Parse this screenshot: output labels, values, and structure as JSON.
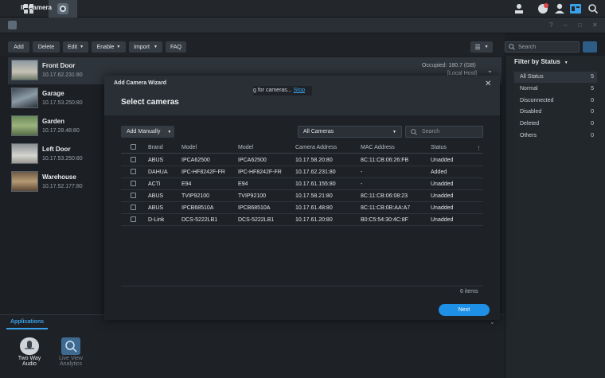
{
  "window": {
    "title": "IP Camera"
  },
  "toolbar": {
    "add": "Add",
    "delete": "Delete",
    "edit": "Edit",
    "enable": "Enable",
    "import": "Import",
    "faq": "FAQ",
    "search_placeholder": "Search"
  },
  "cameras": [
    {
      "name": "Front Door",
      "ip": "10.17.62.231:80"
    },
    {
      "name": "Garage",
      "ip": "10.17.53.250:80"
    },
    {
      "name": "Garden",
      "ip": "10.17.28.48:80"
    },
    {
      "name": "Left Door",
      "ip": "10.17.53.250:80"
    },
    {
      "name": "Warehouse",
      "ip": "10.17.52.177:80"
    }
  ],
  "storage": {
    "occupied": "Occupied: 180.7 (GB)",
    "host": "[Local Host]"
  },
  "filter": {
    "title": "Filter by Status",
    "items": [
      {
        "label": "All Status",
        "count": "5"
      },
      {
        "label": "Normal",
        "count": "5"
      },
      {
        "label": "Disconnected",
        "count": "0"
      },
      {
        "label": "Disabled",
        "count": "0"
      },
      {
        "label": "Deleted",
        "count": "0"
      },
      {
        "label": "Others",
        "count": "0"
      }
    ]
  },
  "applications": {
    "tab": "Applications",
    "items": [
      {
        "label1": "Two Way",
        "label2": "Audio"
      },
      {
        "label1": "Live View",
        "label2": "Analytics"
      }
    ]
  },
  "wizard": {
    "title": "Add Camera Wizard",
    "subtitle": "Select cameras",
    "scanning": "g for cameras...",
    "stop": "Stop",
    "add_manually": "Add Manually",
    "filter_select": "All Cameras",
    "search_placeholder": "Search",
    "columns": [
      "Brand",
      "Model",
      "Model",
      "Camera Address",
      "MAC Address",
      "Status"
    ],
    "rows": [
      {
        "brand": "ABUS",
        "model1": "IPCA62500",
        "model2": "IPCA62500",
        "address": "10.17.58.20:80",
        "mac": "8C:11:CB:06:26:FB",
        "status": "Unadded"
      },
      {
        "brand": "DAHUA",
        "model1": "IPC-HF8242F-FR",
        "model2": "IPC-HF8242F-FR",
        "address": "10.17.62.231:80",
        "mac": "-",
        "status": "Added"
      },
      {
        "brand": "ACTi",
        "model1": "E94",
        "model2": "E94",
        "address": "10.17.61.155:80",
        "mac": "-",
        "status": "Unadded"
      },
      {
        "brand": "ABUS",
        "model1": "TVIP92100",
        "model2": "TVIP92100",
        "address": "10.17.58.21:80",
        "mac": "8C:11:CB:06:08:23",
        "status": "Unadded"
      },
      {
        "brand": "ABUS",
        "model1": "IPCB68510A",
        "model2": "IPCB68510A",
        "address": "10.17.61.48:80",
        "mac": "8C:11:CB:0B:AA:A7",
        "status": "Unadded"
      },
      {
        "brand": "D-Link",
        "model1": "DCS-5222LB1",
        "model2": "DCS-5222LB1",
        "address": "10.17.61.20:80",
        "mac": "B0:C5:54:30:4C:8F",
        "status": "Unadded"
      }
    ],
    "count": "6 items",
    "next": "Next"
  }
}
